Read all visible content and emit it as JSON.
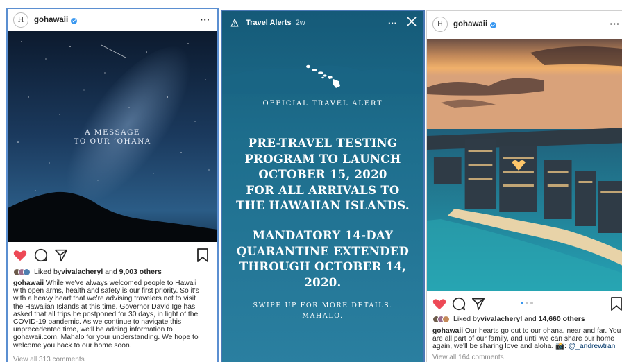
{
  "posts": [
    {
      "username": "gohawaii",
      "image_text": [
        "A MESSAGE",
        "TO OUR ‘OHANA"
      ],
      "liked_by_prefix": "Liked by ",
      "liked_by_user": "vivalacheryl",
      "liked_by_and": " and ",
      "liked_by_count": "9,003 others",
      "caption_user": "gohawaii",
      "caption_lines": [
        " While we've always welcomed people to Hawaii",
        "with open arms, health and safety is our first priority. So it's",
        "with a heavy heart that we're advising travelers not to visit",
        "the Hawaiian Islands at this time. Governor David Ige has",
        "asked that all trips be postponed for 30 days, in light of the",
        "COVID-19 pandemic. As we continue to navigate this",
        "unprecedented time, we'll be adding information to",
        "gohawaii.com. Mahalo for your understanding. We hope to",
        "welcome you back to our home soon."
      ],
      "view_comments": "View all 313 comments"
    },
    {
      "username": "gohawaii",
      "liked_by_prefix": "Liked by ",
      "liked_by_user": "vivalacheryl",
      "liked_by_and": " and ",
      "liked_by_count": "14,660 others",
      "caption_user": "gohawaii",
      "caption_lines": [
        " Our hearts go out to our ohana, near and far. You",
        "are all part of our family, and until we can share our home",
        "again, we'll be sharing love and aloha. 📸: ",
        "@_andrewtran"
      ],
      "view_comments": "View all 164 comments"
    }
  ],
  "story": {
    "title": "Travel Alerts",
    "age": "2w",
    "kicker": "OFFICIAL TRAVEL ALERT",
    "headline1": [
      "PRE-TRAVEL TESTING",
      "PROGRAM TO LAUNCH",
      "OCTOBER 15, 2020",
      "FOR ALL ARRIVALS TO",
      "THE HAWAIIAN ISLANDS."
    ],
    "headline2": [
      "MANDATORY 14-DAY",
      "QUARANTINE EXTENDED",
      "THROUGH OCTOBER 14, 2020."
    ],
    "footer": [
      "SWIPE UP FOR MORE DETAILS.",
      "MAHALO."
    ]
  },
  "colors": {
    "like_red": "#ed4956",
    "verified_blue": "#3897f0",
    "story_bg": "#1f6f8e",
    "mention_blue": "#00376b"
  },
  "icons": [
    "hawaii-logo-icon",
    "verified-icon",
    "more-icon",
    "heart-icon",
    "comment-icon",
    "share-icon",
    "bookmark-icon",
    "warning-icon",
    "close-icon"
  ]
}
